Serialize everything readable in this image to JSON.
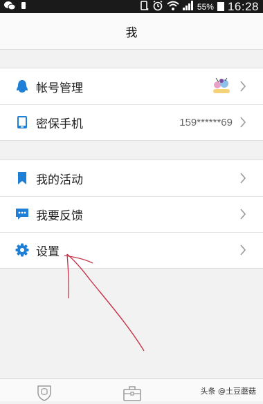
{
  "status_bar": {
    "battery_percent": "55%",
    "time": "16:28"
  },
  "header": {
    "title": "我"
  },
  "account_group": {
    "items": [
      {
        "label": "帐号管理",
        "icon": "qq-penguin-icon",
        "value": ""
      },
      {
        "label": "密保手机",
        "icon": "phone-icon",
        "value": "159******69"
      }
    ]
  },
  "menu_group": {
    "items": [
      {
        "label": "我的活动",
        "icon": "bookmark-icon"
      },
      {
        "label": "我要反馈",
        "icon": "chat-bubble-icon"
      },
      {
        "label": "设置",
        "icon": "gear-icon"
      }
    ]
  },
  "bottom_tabs": [
    {
      "icon": "shield-face-icon"
    },
    {
      "icon": "toolbox-icon"
    }
  ],
  "watermark": "头条 @土豆蘑菇",
  "colors": {
    "accent": "#1e7fd6",
    "status_bar": "#1a1a1a",
    "annotation": "#c8324a"
  }
}
